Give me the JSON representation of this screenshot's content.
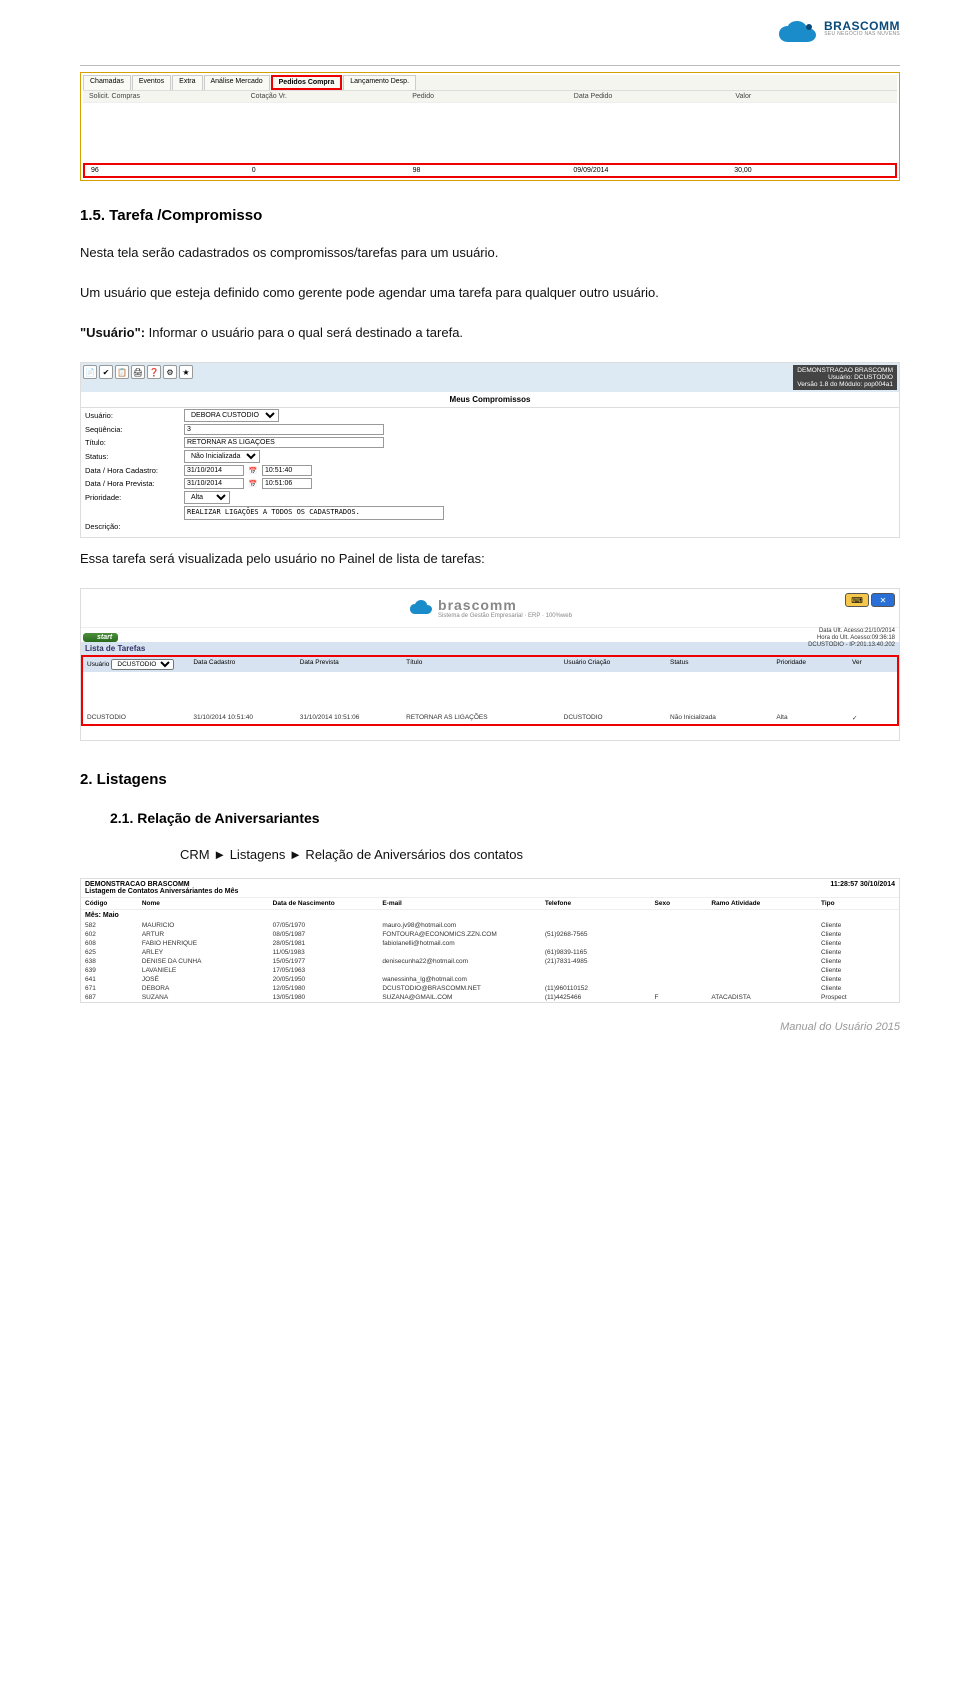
{
  "header": {
    "brand": "BRASCOMM",
    "tagline": "SEU NEGÓCIO NAS NUVENS"
  },
  "shot1": {
    "tabs": [
      "Chamadas",
      "Eventos",
      "Extra",
      "Análise Mercado",
      "Pedidos Compra",
      "Lançamento Desp."
    ],
    "selected_tab_index": 4,
    "headers": [
      "Solicit. Compras",
      "Cotação Vr.",
      "Pedido",
      "Data Pedido",
      "Valor"
    ],
    "row": [
      "96",
      "0",
      "98",
      "09/09/2014",
      "30,00"
    ]
  },
  "section15": {
    "title": "1.5.     Tarefa /Compromisso",
    "para1": "Nesta tela serão cadastrados os compromissos/tarefas para um usuário.",
    "para2": "Um usuário que esteja definido como gerente pode agendar uma tarefa para qualquer outro usuário.",
    "quote_label": "\"Usuário\":",
    "quote_rest": " Informar o usuário para o qual será destinado a tarefa."
  },
  "formshot": {
    "corp": "DEMONSTRACAO BRASCOMM",
    "user": "Usuário: DCUSTODIO",
    "ver": "Versão 1.8 do Módulo: pop004a1",
    "title": "Meus Compromissos",
    "fields": {
      "usuario_label": "Usuário:",
      "usuario_value": "DEBORA CUSTODIO",
      "seq_label": "Seqüência:",
      "seq_value": "3",
      "titulo_label": "Título:",
      "titulo_value": "RETORNAR AS LIGAÇÕES",
      "status_label": "Status:",
      "status_value": "Não Inicializada",
      "cad_label": "Data / Hora Cadastro:",
      "cad_date": "31/10/2014",
      "cad_time": "10:51:40",
      "prev_label": "Data / Hora Prevista:",
      "prev_date": "31/10/2014",
      "prev_time": "10:51:06",
      "prio_label": "Prioridade:",
      "prio_value": "Alta",
      "desc_label": "Descrição:",
      "desc_value": "REALIZAR LIGAÇÕES A TODOS OS CADASTRADOS."
    }
  },
  "after_form_text": "Essa tarefa será visualizada pelo usuário no Painel de lista de tarefas:",
  "panelshot": {
    "brand": "brascomm",
    "brand_sub": "Sistema de Gestão Empresarial · ERP · 100%web",
    "start": "start",
    "meta1": "Data Ult. Acesso:21/10/2014",
    "meta2": "Hora do Ult. Acesso:09:36:18",
    "meta3": "DCUSTODIO - IP:201.13.40.202",
    "list_title": "Lista de Tarefas",
    "cols_user_label": "Usuário",
    "cols_user_value": "DCUSTODIO",
    "cols": [
      "Data Cadastro",
      "Data Prevista",
      "Título",
      "Usuário Criação",
      "Status",
      "Prioridade",
      "Ver"
    ],
    "row": [
      "DCUSTODIO",
      "31/10/2014 10:51:40",
      "31/10/2014 10:51:06",
      "RETORNAR AS LIGAÇÕES",
      "DCUSTODIO",
      "Não Inicializada",
      "Alta",
      "✓"
    ]
  },
  "section2": {
    "title": "2.   Listagens",
    "sub": "2.1.    Relação de Aniversariantes",
    "crm": "CRM ► Listagens ► Relação de Aniversários dos contatos"
  },
  "listshot": {
    "h1": "DEMONSTRACAO BRASCOMM",
    "h2": "Listagem de Contatos Aniversáriantes do Mês",
    "time": "11:28:57 30/10/2014",
    "cols": [
      "Código",
      "Nome",
      "Data de Nascimento",
      "E-mail",
      "Telefone",
      "Sexo",
      "Ramo Atividade",
      "Tipo"
    ],
    "mes": "Mês: Maio",
    "rows": [
      [
        "582",
        "MAURICIO",
        "07/05/1970",
        "mauro.jv98@hotmail.com",
        "",
        "",
        "",
        "Cliente"
      ],
      [
        "602",
        "ARTUR",
        "08/05/1987",
        "FONTOURA@ECONOMICS.ZZN.COM",
        "(51)9268-7565",
        "",
        "",
        "Cliente"
      ],
      [
        "608",
        "FABIO HENRIQUE",
        "28/05/1981",
        "fabiolanelli@hotmail.com",
        "",
        "",
        "",
        "Cliente"
      ],
      [
        "625",
        "ARLEY",
        "11/05/1983",
        "",
        "(61)9839-1165",
        "",
        "",
        "Cliente"
      ],
      [
        "638",
        "DENISE DA CUNHA",
        "15/05/1977",
        "denisecunha22@hotmail.com",
        "(21)7831-4985",
        "",
        "",
        "Cliente"
      ],
      [
        "639",
        "LAVANIELE",
        "17/05/1963",
        "",
        "",
        "",
        "",
        "Cliente"
      ],
      [
        "641",
        "JOSÉ",
        "20/05/1950",
        "wanessinha_lg@hotmail.com",
        "",
        "",
        "",
        "Cliente"
      ],
      [
        "671",
        "DEBORA",
        "12/05/1980",
        "DCUSTODIO@BRASCOMM.NET",
        "(11)960110152",
        "",
        "",
        "Cliente"
      ],
      [
        "687",
        "SUZANA",
        "13/05/1980",
        "SUZANA@GMAIL.COM",
        "(11)4425466",
        "F",
        "ATACADISTA",
        "Prospect"
      ]
    ]
  },
  "footer": "Manual do Usuário 2015"
}
